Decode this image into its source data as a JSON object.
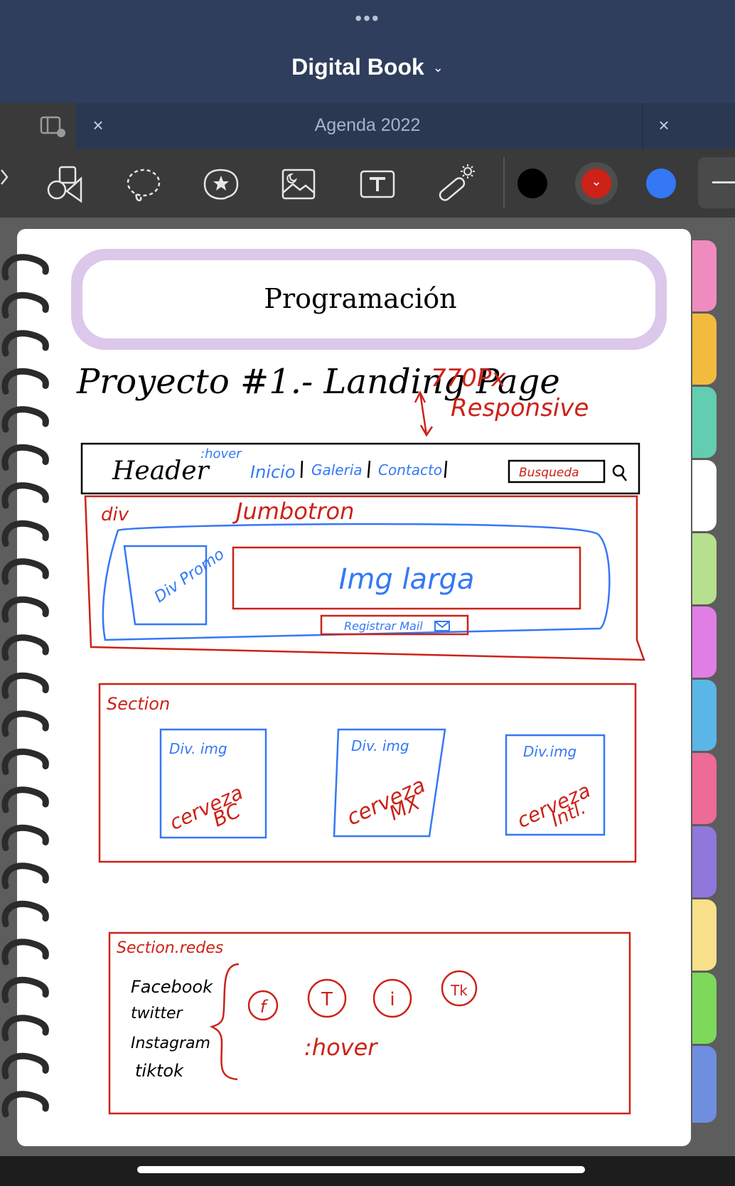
{
  "app": {
    "dots": "•••",
    "title": "Digital Book",
    "title_chevron": "⌄"
  },
  "tab": {
    "close_left": "×",
    "title": "Agenda 2022",
    "close_right": "×"
  },
  "toolbar": {
    "tools": [
      "shapes-icon",
      "lasso-icon",
      "sticker-icon",
      "image-icon",
      "text-icon",
      "laser-pointer-icon"
    ],
    "colors": {
      "black": "#000000",
      "red": "#cc2218",
      "blue": "#3478f6"
    },
    "selected_color_chevron": "⌄"
  },
  "notebook": {
    "title": "Programación",
    "heading": "Proyecto #1.- Landing Page",
    "note_width": "770Px",
    "note_responsive": "Responsive",
    "header_label": "Header",
    "header_hover": ":hover",
    "nav_inicio": "Inicio",
    "nav_galeria": "Galeria",
    "nav_contacto": "Contacto",
    "search_label": "Busqueda",
    "div_label": "div",
    "jumbotron_label": "Jumbotron",
    "div_promo": "Div Promo",
    "img_larga": "Img larga",
    "registrar_mail": "Registrar Mail",
    "section_label": "Section",
    "card_bc_div": "Div. img",
    "card_bc_text1": "cerveza",
    "card_bc_text2": "BC",
    "card_mx_div": "Div. img",
    "card_mx_text1": "cerveza",
    "card_mx_text2": "MX",
    "card_intl_div": "Div.img",
    "card_intl_text1": "cerveza",
    "card_intl_text2": "Intl.",
    "redes_label": "Section.redes",
    "redes_facebook": "Facebook",
    "redes_twitter": "twitter",
    "redes_instagram": "Instagram",
    "redes_tiktok": "tiktok",
    "icon_f": "f",
    "icon_t": "T",
    "icon_i": "i",
    "icon_tk": "Tk",
    "redes_hover": ":hover"
  },
  "side_tabs": [
    "#f08bc0",
    "#f2bb3e",
    "#63cdb0",
    "#ffffff",
    "#b6e08e",
    "#e07ee6",
    "#5ab6e6",
    "#ee6a97",
    "#8f77dc",
    "#f8e08a",
    "#7ed85a",
    "#6e8ee0"
  ]
}
